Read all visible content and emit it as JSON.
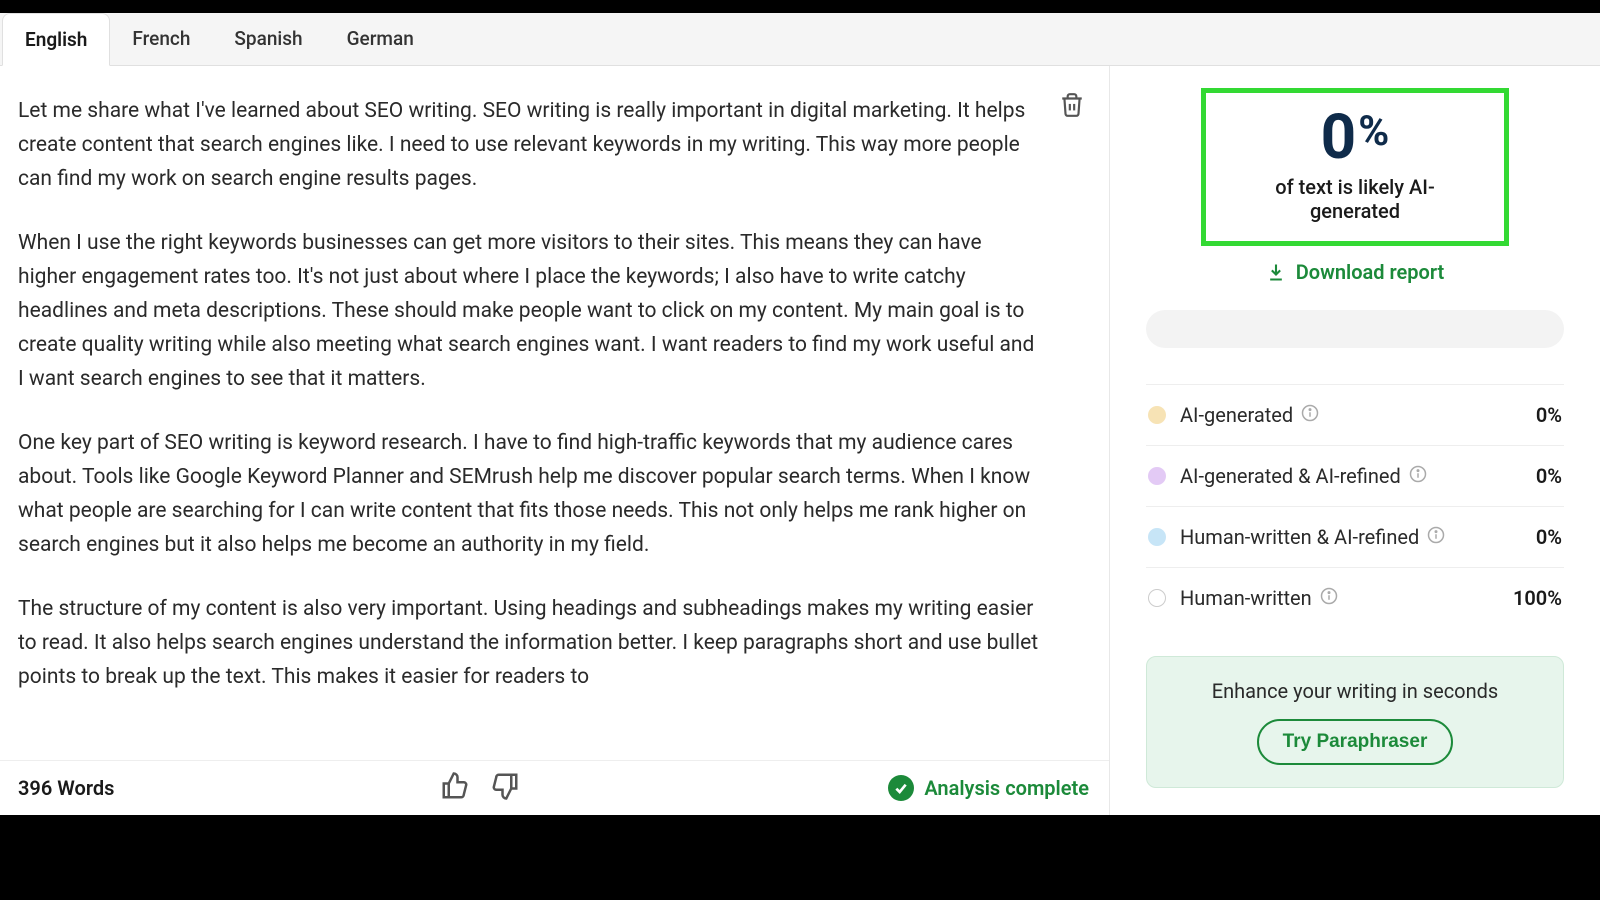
{
  "tabs": [
    {
      "label": "English",
      "active": true
    },
    {
      "label": "French",
      "active": false
    },
    {
      "label": "Spanish",
      "active": false
    },
    {
      "label": "German",
      "active": false
    }
  ],
  "paragraphs": [
    "Let me share what I've learned about SEO writing. SEO writing is really important in digital marketing. It helps create content that search engines like. I need to use relevant keywords in my writing. This way  more people can find my work on search engine results pages.",
    "When I use the right keywords  businesses can get more visitors to their sites. This means they can have higher engagement rates too. It's not just about where I place the keywords; I also have to write catchy headlines and meta descriptions. These should make people want to click on my content. My main goal is to create quality writing while also meeting what search engines want. I want readers to find my work useful  and I want search engines to see that it matters.",
    "One key part of SEO writing is keyword research. I have to find high-traffic keywords that my audience cares about. Tools like Google Keyword Planner and SEMrush help me discover popular search terms. When I know what people are searching for  I can write content that fits those needs. This not only helps me rank higher on search engines  but it also helps me become an authority in my field.",
    "The structure of my content is also very important. Using headings and subheadings makes my writing easier to read. It also helps search engines understand the information better. I keep paragraphs short and use bullet points to break up the text. This makes it easier for readers to"
  ],
  "footer": {
    "word_count": "396 Words",
    "status": "Analysis complete"
  },
  "result": {
    "percent": "0",
    "percent_symbol": "%",
    "label": "of text is likely AI-generated",
    "download": "Download report"
  },
  "breakdown": [
    {
      "label": "AI-generated",
      "value": "0%",
      "color": "#f7e3b5"
    },
    {
      "label": "AI-generated & AI-refined",
      "value": "0%",
      "color": "#e3caf5"
    },
    {
      "label": "Human-written & AI-refined",
      "value": "0%",
      "color": "#c7e5f7"
    },
    {
      "label": "Human-written",
      "value": "100%",
      "color": "#ffffff"
    }
  ],
  "enhance": {
    "title": "Enhance your writing in seconds",
    "button": "Try Paraphraser"
  }
}
